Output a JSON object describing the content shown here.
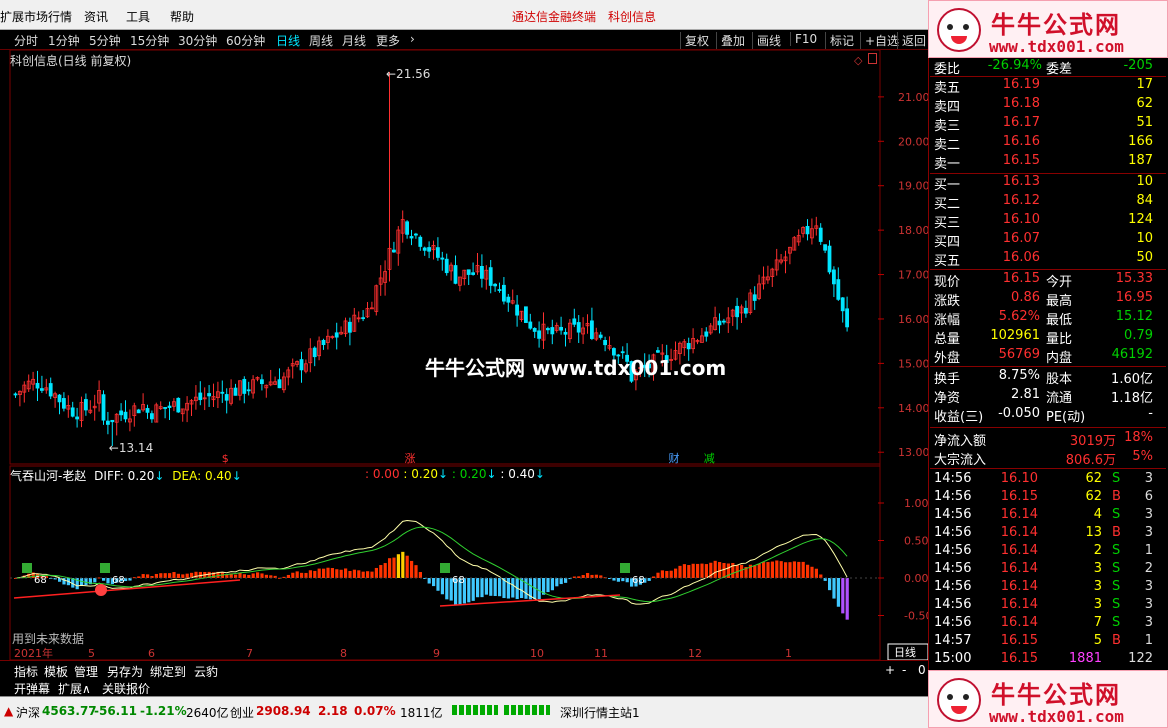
{
  "menu": {
    "items": [
      "扩展市场行情",
      "资讯",
      "工具",
      "帮助"
    ],
    "ad1": "通达信金融终端",
    "ad2": "科创信息"
  },
  "banner": {
    "title": "牛牛公式网",
    "url": "www.tdx001.com"
  },
  "toolbar": {
    "periods": [
      "分时",
      "1分钟",
      "5分钟",
      "15分钟",
      "30分钟",
      "60分钟",
      "日线",
      "周线",
      "月线",
      "更多"
    ],
    "right": [
      "复权",
      "叠加",
      "画线",
      "F10",
      "标记",
      "+自选",
      "返回"
    ]
  },
  "chart": {
    "title": "科创信息(日线 前复权)",
    "high_label": "21.56",
    "low_label": "13.14",
    "y_labels": [
      "21.00",
      "20.00",
      "19.00",
      "18.00",
      "17.00",
      "16.00",
      "15.00",
      "14.00",
      "13.00"
    ],
    "markers": [
      {
        "t": "$",
        "c": "#ff3030"
      },
      {
        "t": "涨",
        "c": "#ff3030"
      },
      {
        "t": "财",
        "c": "#4aa0ff"
      },
      {
        "t": "减",
        "c": "#00d000"
      }
    ]
  },
  "watermark": "牛牛公式网 www.tdx001.com",
  "indicator": {
    "title": "气吞山河-老赵",
    "diff": "DIFF: 0.20",
    "dea": "DEA: 0.40",
    "extra": [
      ": 0.00",
      ": 0.20",
      ": 0.20",
      ": 0.40"
    ],
    "y_labels": [
      "1.00",
      "0.50",
      "0.00",
      "-0.50"
    ],
    "note": "用到未来数据",
    "tag68a": "68",
    "tag68b": "68",
    "tag68c": "68",
    "tag68d": "68"
  },
  "dates": [
    "2021年",
    "5",
    "6",
    "7",
    "8",
    "9",
    "10",
    "11",
    "12",
    "1"
  ],
  "period_tag": "日线",
  "quote": {
    "wb_label": "委比",
    "wb_val": "-26.94%",
    "wc_label": "委差",
    "wc_val": "-205",
    "asks": [
      {
        "n": "卖五",
        "p": "16.19",
        "v": "17"
      },
      {
        "n": "卖四",
        "p": "16.18",
        "v": "62"
      },
      {
        "n": "卖三",
        "p": "16.17",
        "v": "51"
      },
      {
        "n": "卖二",
        "p": "16.16",
        "v": "166"
      },
      {
        "n": "卖一",
        "p": "16.15",
        "v": "187"
      }
    ],
    "bids": [
      {
        "n": "买一",
        "p": "16.13",
        "v": "10"
      },
      {
        "n": "买二",
        "p": "16.12",
        "v": "84"
      },
      {
        "n": "买三",
        "p": "16.10",
        "v": "124"
      },
      {
        "n": "买四",
        "p": "16.07",
        "v": "10"
      },
      {
        "n": "买五",
        "p": "16.06",
        "v": "50"
      }
    ],
    "stats": [
      {
        "l1": "现价",
        "v1": "16.15",
        "c1": "red",
        "l2": "今开",
        "v2": "15.33",
        "c2": "red"
      },
      {
        "l1": "涨跌",
        "v1": "0.86",
        "c1": "red",
        "l2": "最高",
        "v2": "16.95",
        "c2": "red"
      },
      {
        "l1": "涨幅",
        "v1": "5.62%",
        "c1": "red",
        "l2": "最低",
        "v2": "15.12",
        "c2": "green"
      },
      {
        "l1": "总量",
        "v1": "102961",
        "c1": "yellow",
        "l2": "量比",
        "v2": "0.79",
        "c2": "green"
      },
      {
        "l1": "外盘",
        "v1": "56769",
        "c1": "red",
        "l2": "内盘",
        "v2": "46192",
        "c2": "green"
      }
    ],
    "stats2": [
      {
        "l1": "换手",
        "v1": "8.75%",
        "l2": "股本",
        "v2": "1.60亿"
      },
      {
        "l1": "净资",
        "v1": "2.81",
        "l2": "流通",
        "v2": "1.18亿"
      },
      {
        "l1": "收益(三)",
        "v1": "-0.050",
        "l2": "PE(动)",
        "v2": "-"
      }
    ],
    "flow": [
      {
        "l": "净流入额",
        "v": "3019万",
        "p": "18%"
      },
      {
        "l": "大宗流入",
        "v": "806.6万",
        "p": "5%"
      }
    ],
    "ticks": [
      {
        "t": "14:56",
        "p": "16.10",
        "v": "62",
        "bs": "S",
        "n": "3"
      },
      {
        "t": "14:56",
        "p": "16.15",
        "v": "62",
        "bs": "B",
        "n": "6"
      },
      {
        "t": "14:56",
        "p": "16.14",
        "v": "4",
        "bs": "S",
        "n": "3"
      },
      {
        "t": "14:56",
        "p": "16.14",
        "v": "13",
        "bs": "B",
        "n": "3"
      },
      {
        "t": "14:56",
        "p": "16.14",
        "v": "2",
        "bs": "S",
        "n": "1"
      },
      {
        "t": "14:56",
        "p": "16.14",
        "v": "3",
        "bs": "S",
        "n": "2"
      },
      {
        "t": "14:56",
        "p": "16.14",
        "v": "3",
        "bs": "S",
        "n": "3"
      },
      {
        "t": "14:56",
        "p": "16.14",
        "v": "3",
        "bs": "S",
        "n": "3"
      },
      {
        "t": "14:56",
        "p": "16.14",
        "v": "7",
        "bs": "S",
        "n": "3"
      },
      {
        "t": "14:57",
        "p": "16.15",
        "v": "5",
        "bs": "B",
        "n": "1"
      },
      {
        "t": "15:00",
        "p": "16.15",
        "v": "1881",
        "bs": "",
        "n": "122"
      }
    ]
  },
  "tabs": [
    "指标",
    "模板",
    "管理",
    "另存为",
    "绑定到",
    "云豹"
  ],
  "tabs2": [
    "开弹幕",
    "扩展∧",
    "关联报价"
  ],
  "status": {
    "sh_name": "沪深",
    "sh_val": "4563.77",
    "sh_chg": "-56.11",
    "sh_pct": "-1.21%",
    "sh_amt": "2640亿",
    "cy_name": "创业",
    "cy_val": "2908.94",
    "cy_chg": "2.18",
    "cy_pct": "0.07%",
    "cy_amt": "1811亿",
    "server": "深圳行情主站1"
  }
}
